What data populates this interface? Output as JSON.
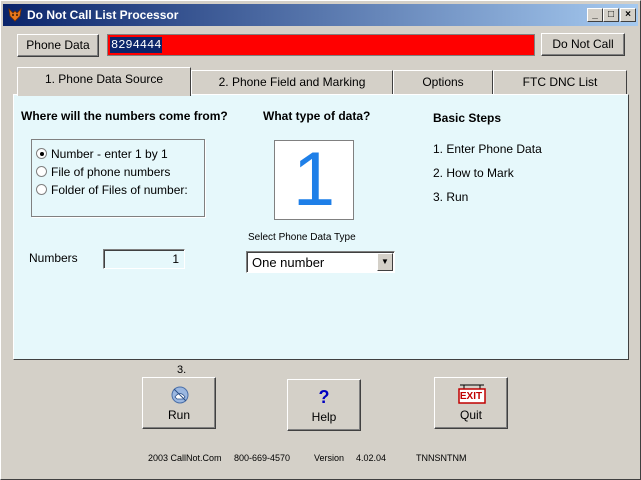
{
  "window": {
    "title": "Do Not Call List Processor",
    "controls": {
      "minimize": "_",
      "maximize": "□",
      "close": "×"
    }
  },
  "toolbar": {
    "phone_data_label": "Phone Data",
    "phone_value": "8294444",
    "do_not_call_label": "Do Not Call"
  },
  "tabs": [
    {
      "label": "1. Phone Data Source",
      "active": true
    },
    {
      "label": "2. Phone Field and Marking",
      "active": false
    },
    {
      "label": "Options",
      "active": false
    },
    {
      "label": "FTC DNC List",
      "active": false
    }
  ],
  "source": {
    "heading": "Where will the numbers come from?",
    "options": [
      {
        "label": "Number - enter 1 by 1",
        "selected": true
      },
      {
        "label": "File of phone numbers",
        "selected": false
      },
      {
        "label": "Folder of Files of number:",
        "selected": false
      }
    ],
    "numbers_label": "Numbers",
    "numbers_value": "1"
  },
  "datatype": {
    "heading": "What type of data?",
    "big_digit": "1",
    "select_label": "Select Phone Data Type",
    "selected_value": "One number"
  },
  "steps": {
    "heading": "Basic Steps",
    "items": [
      "1. Enter Phone Data",
      "2. How to Mark",
      "3. Run"
    ]
  },
  "actions": {
    "step_number": "3.",
    "run_label": "Run",
    "help_label": "Help",
    "quit_label": "Quit",
    "exit_sign": "EXIT",
    "help_glyph": "?"
  },
  "footer": {
    "company": "2003  CallNot.Com",
    "phone": "800-669-4570",
    "version_label": "Version",
    "version": "4.02.04",
    "code": "TNNSNTNM"
  },
  "colors": {
    "title_start": "#0a246a",
    "phone_bar": "#ff0000",
    "panel": "#e6f8fb",
    "digit": "#1e7fe8"
  }
}
